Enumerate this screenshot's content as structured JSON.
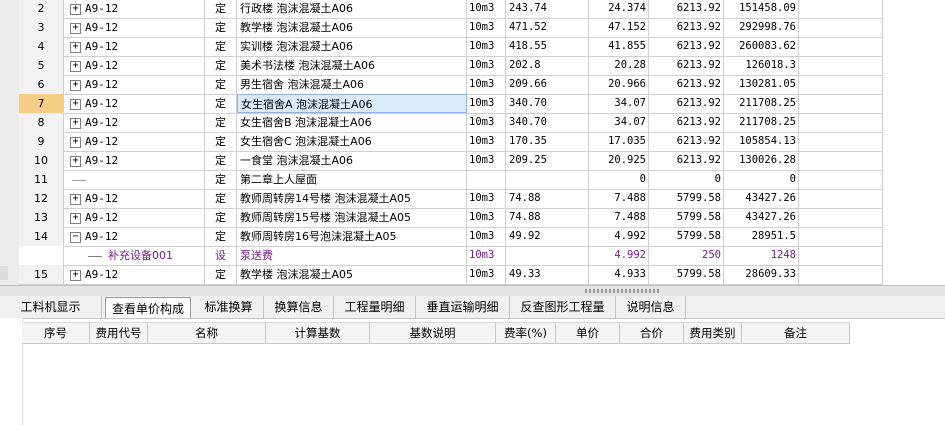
{
  "rows": [
    {
      "num": "2",
      "expand": "+",
      "code": "A9-12",
      "type": "定",
      "name": "行政楼 泡沫混凝土A06",
      "unit": "10m3",
      "qty": "243.74",
      "cqty": "24.374",
      "price": "6213.92",
      "total": "151458.09"
    },
    {
      "num": "3",
      "expand": "+",
      "code": "A9-12",
      "type": "定",
      "name": "教学楼 泡沫混凝土A06",
      "unit": "10m3",
      "qty": "471.52",
      "cqty": "47.152",
      "price": "6213.92",
      "total": "292998.76"
    },
    {
      "num": "4",
      "expand": "+",
      "code": "A9-12",
      "type": "定",
      "name": "实训楼 泡沫混凝土A06",
      "unit": "10m3",
      "qty": "418.55",
      "cqty": "41.855",
      "price": "6213.92",
      "total": "260083.62"
    },
    {
      "num": "5",
      "expand": "+",
      "code": "A9-12",
      "type": "定",
      "name": "美术书法楼 泡沫混凝土A06",
      "unit": "10m3",
      "qty": "202.8",
      "cqty": "20.28",
      "price": "6213.92",
      "total": "126018.3"
    },
    {
      "num": "6",
      "expand": "+",
      "code": "A9-12",
      "type": "定",
      "name": "男生宿舍 泡沫混凝土A06",
      "unit": "10m3",
      "qty": "209.66",
      "cqty": "20.966",
      "price": "6213.92",
      "total": "130281.05"
    },
    {
      "num": "7",
      "expand": "+",
      "code": "A9-12",
      "type": "定",
      "name": "女生宿舍A 泡沫混凝土A06",
      "unit": "10m3",
      "qty": "340.70",
      "cqty": "34.07",
      "price": "6213.92",
      "total": "211708.25"
    },
    {
      "num": "8",
      "expand": "+",
      "code": "A9-12",
      "type": "定",
      "name": "女生宿舍B 泡沫混凝土A06",
      "unit": "10m3",
      "qty": "340.70",
      "cqty": "34.07",
      "price": "6213.92",
      "total": "211708.25"
    },
    {
      "num": "9",
      "expand": "+",
      "code": "A9-12",
      "type": "定",
      "name": "女生宿舍C 泡沫混凝土A06",
      "unit": "10m3",
      "qty": "170.35",
      "cqty": "17.035",
      "price": "6213.92",
      "total": "105854.13"
    },
    {
      "num": "10",
      "expand": "+",
      "code": "A9-12",
      "type": "定",
      "name": "一食堂 泡沫混凝土A06",
      "unit": "10m3",
      "qty": "209.25",
      "cqty": "20.925",
      "price": "6213.92",
      "total": "130026.28"
    },
    {
      "num": "11",
      "expand": "",
      "code": "",
      "type": "定",
      "name": "第二章上人屋面",
      "unit": "",
      "qty": "",
      "cqty": "0",
      "price": "0",
      "total": "0"
    },
    {
      "num": "12",
      "expand": "+",
      "code": "A9-12",
      "type": "定",
      "name": "教师周转房14号楼 泡沫混凝土A05",
      "unit": "10m3",
      "qty": "74.88",
      "cqty": "7.488",
      "price": "5799.58",
      "total": "43427.26"
    },
    {
      "num": "13",
      "expand": "+",
      "code": "A9-12",
      "type": "定",
      "name": "教师周转房15号楼 泡沫混凝土A05",
      "unit": "10m3",
      "qty": "74.88",
      "cqty": "7.488",
      "price": "5799.58",
      "total": "43427.26"
    },
    {
      "num": "14",
      "expand": "−",
      "code": "A9-12",
      "type": "定",
      "name": "教师周转房16号泡沫混凝土A05",
      "unit": "10m3",
      "qty": "49.92",
      "cqty": "4.992",
      "price": "5799.58",
      "total": "28951.5"
    },
    {
      "num": "",
      "expand": "",
      "code": "补充设备001",
      "type": "设",
      "name": "泵送费",
      "unit": "10m3",
      "qty": "",
      "cqty": "4.992",
      "price": "250",
      "total": "1248"
    },
    {
      "num": "15",
      "expand": "+",
      "code": "A9-12",
      "type": "定",
      "name": "教学楼 泡沫混凝土A05",
      "unit": "10m3",
      "qty": "49.33",
      "cqty": "4.933",
      "price": "5799.58",
      "total": "28609.33"
    }
  ],
  "tabs": [
    "工料机显示",
    "查看单价构成",
    "标准换算",
    "换算信息",
    "工程量明细",
    "垂直运输明细",
    "反查图形工程量",
    "说明信息"
  ],
  "columns": [
    "序号",
    "费用代号",
    "名称",
    "计算基数",
    "基数说明",
    "费率(%)",
    "单价",
    "合价",
    "费用类别",
    "备注"
  ]
}
